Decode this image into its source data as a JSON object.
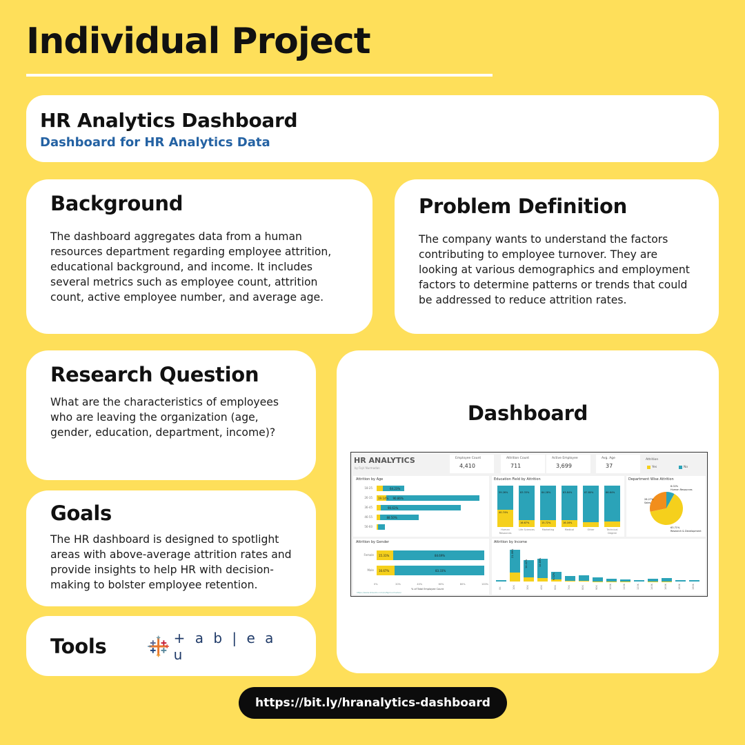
{
  "page": {
    "title": "Individual Project",
    "url": "https://bit.ly/hranalytics-dashboard"
  },
  "project": {
    "name": "HR Analytics Dashboard",
    "subtitle": "Dashboard for HR Analytics Data"
  },
  "background": {
    "heading": "Background",
    "text": "The dashboard aggregates data from a human resources department regarding employee attrition, educational background, and income. It includes several metrics such as employee count, attrition count, active employee number, and average age."
  },
  "problem": {
    "heading": "Problem Definition",
    "text": "The company wants to understand the factors contributing to employee turnover. They are looking at various demographics and employment factors to determine patterns or trends that could be addressed to reduce attrition rates."
  },
  "research": {
    "heading": "Research Question",
    "text": "What are the characteristics of employees who are leaving the organization (age, gender, education, department, income)?"
  },
  "goals": {
    "heading": "Goals",
    "text": "The HR dashboard is designed to spotlight areas with above-average attrition rates and provide insights to help HR with decision-making to bolster employee retention."
  },
  "tools": {
    "heading": "Tools",
    "logo_text": "+ a b | e a u",
    "logo_icon": "tableau-icon"
  },
  "dashboard": {
    "heading": "Dashboard",
    "shot": {
      "title": "HR ANALYTICS",
      "byline": "by Fajri Nurmadan",
      "kpis": [
        {
          "label": "Employee Count",
          "value": "4,410"
        },
        {
          "label": "Attrition Count",
          "value": "711"
        },
        {
          "label": "Active Employee",
          "value": "3,699"
        },
        {
          "label": "Avg. Age",
          "value": "37"
        }
      ],
      "attrition_legend": {
        "title": "Attrition",
        "yes": "Yes",
        "no": "No"
      },
      "age": {
        "title": "Attrition by Age",
        "rows": [
          {
            "label": "18-25",
            "yes_label": "",
            "no_label": "64.23%",
            "yes": 0.12,
            "no": 0.22
          },
          {
            "label": "26-35",
            "yes_label": "19.14%",
            "no_label": "90.86%",
            "yes": 0.18,
            "no": 0.92
          },
          {
            "label": "36-45",
            "yes_label": "",
            "no_label": "90.61%",
            "yes": 0.08,
            "no": 0.78
          },
          {
            "label": "46-55",
            "yes_label": "",
            "no_label": "88.50%",
            "yes": 0.06,
            "no": 0.38
          },
          {
            "label": "56-60",
            "yes_label": "",
            "no_label": "",
            "yes": 0.02,
            "no": 0.07
          }
        ]
      },
      "education": {
        "title": "Education Field by Attrition",
        "fields": [
          {
            "label": "Human Resources",
            "no_label": "59.26%",
            "yes_label": "40.74%",
            "yes": 0.41
          },
          {
            "label": "Life Sciences",
            "no_label": "83.33%",
            "yes_label": "16.67%",
            "yes": 0.17
          },
          {
            "label": "Marketing",
            "no_label": "84.28%",
            "yes_label": "15.72%",
            "yes": 0.16
          },
          {
            "label": "Medical",
            "no_label": "83.84%",
            "yes_label": "16.16%",
            "yes": 0.16
          },
          {
            "label": "Other",
            "no_label": "87.80%",
            "yes_label": "",
            "yes": 0.12
          },
          {
            "label": "Technical Degree",
            "no_label": "86.64%",
            "yes_label": "",
            "yes": 0.13
          }
        ]
      },
      "department": {
        "title": "Department Wise Attrition",
        "slices": [
          {
            "name": "Sales",
            "label": "28.27%",
            "value": 28.27,
            "color": "#f28e1c"
          },
          {
            "name": "Human Resources",
            "label": "8.02%",
            "value": 8.02,
            "color": "#2ba3b8"
          },
          {
            "name": "Research & Development",
            "label": "63.71%",
            "value": 63.71,
            "color": "#f5d01c"
          }
        ]
      },
      "gender": {
        "title": "Attrition by Gender",
        "rows": [
          {
            "label": "Female",
            "yes_label": "15.31%",
            "no_label": "84.69%",
            "yes": 0.1531
          },
          {
            "label": "Male",
            "yes_label": "16.67%",
            "no_label": "83.33%",
            "yes": 0.1667
          }
        ],
        "ticks": [
          "0%",
          "20%",
          "40%",
          "60%",
          "80%",
          "100%"
        ],
        "xlabel": "% of Total Employee Count",
        "link": "https://www.linkedin.com/in/fajrinurmadan/"
      },
      "income": {
        "title": "Attrition by Income",
        "categories": [
          "0K",
          "10K",
          "30K",
          "40K",
          "60K",
          "70K",
          "80K",
          "90K",
          "100K",
          "110K",
          "120K",
          "140K",
          "160K",
          "180K",
          "190K"
        ],
        "totals": [
          0.04,
          1.0,
          0.68,
          0.72,
          0.3,
          0.18,
          0.2,
          0.12,
          0.08,
          0.07,
          0.05,
          0.09,
          0.1,
          0.05,
          0.04
        ],
        "yes": [
          0.0,
          0.28,
          0.12,
          0.1,
          0.06,
          0.02,
          0.03,
          0.01,
          0.01,
          0.01,
          0.0,
          0.01,
          0.01,
          0.0,
          0.0
        ],
        "bar_labels": [
          "",
          "21.09%",
          "14.42%",
          "14.89%",
          "9.32%",
          "",
          "",
          "",
          "",
          "",
          "",
          "",
          "",
          "",
          ""
        ]
      },
      "colors": {
        "yes": "#f5d01c",
        "no": "#2ba3b8"
      }
    }
  }
}
